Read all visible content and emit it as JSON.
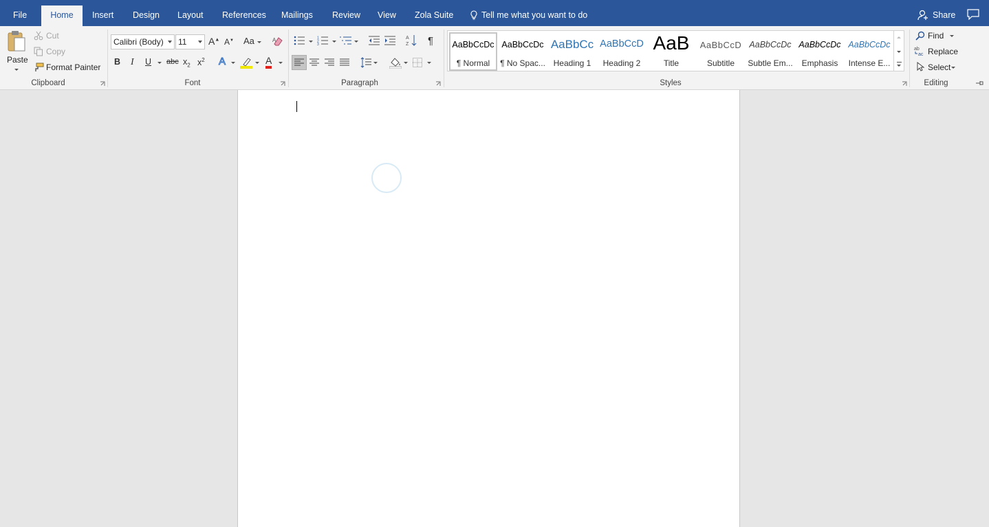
{
  "tabs": [
    {
      "label": "File",
      "active": false
    },
    {
      "label": "Home",
      "active": true
    },
    {
      "label": "Insert",
      "active": false
    },
    {
      "label": "Design",
      "active": false
    },
    {
      "label": "Layout",
      "active": false
    },
    {
      "label": "References",
      "active": false
    },
    {
      "label": "Mailings",
      "active": false
    },
    {
      "label": "Review",
      "active": false
    },
    {
      "label": "View",
      "active": false
    },
    {
      "label": "Zola Suite",
      "active": false
    }
  ],
  "tell_me": "Tell me what you want to do",
  "share": "Share",
  "clipboard": {
    "paste": "Paste",
    "cut": "Cut",
    "copy": "Copy",
    "format_painter": "Format Painter",
    "label": "Clipboard"
  },
  "font": {
    "name": "Calibri (Body)",
    "size": "11",
    "label": "Font",
    "bold": "B",
    "italic": "I",
    "underline": "U",
    "strike": "abc",
    "sub": "x",
    "sub_mark": "2",
    "sup": "x",
    "sup_mark": "2",
    "change_case": "Aa",
    "grow": "A",
    "shrink": "A",
    "effects": "A",
    "color_a": "A"
  },
  "paragraph": {
    "label": "Paragraph",
    "pilcrow": "¶"
  },
  "styles": {
    "label": "Styles",
    "items": [
      {
        "preview": "AaBbCcDc",
        "name": "¶ Normal"
      },
      {
        "preview": "AaBbCcDc",
        "name": "¶ No Spac..."
      },
      {
        "preview": "AaBbCc",
        "name": "Heading 1"
      },
      {
        "preview": "AaBbCcD",
        "name": "Heading 2"
      },
      {
        "preview": "AaB",
        "name": "Title"
      },
      {
        "preview": "AaBbCcD",
        "name": "Subtitle"
      },
      {
        "preview": "AaBbCcDc",
        "name": "Subtle Em..."
      },
      {
        "preview": "AaBbCcDc",
        "name": "Emphasis"
      },
      {
        "preview": "AaBbCcDc",
        "name": "Intense E..."
      }
    ]
  },
  "editing": {
    "find": "Find",
    "replace": "Replace",
    "select": "Select",
    "label": "Editing"
  },
  "colors": {
    "brand": "#2b579a",
    "font_color": "#e0201b",
    "highlight": "#f0e800"
  }
}
